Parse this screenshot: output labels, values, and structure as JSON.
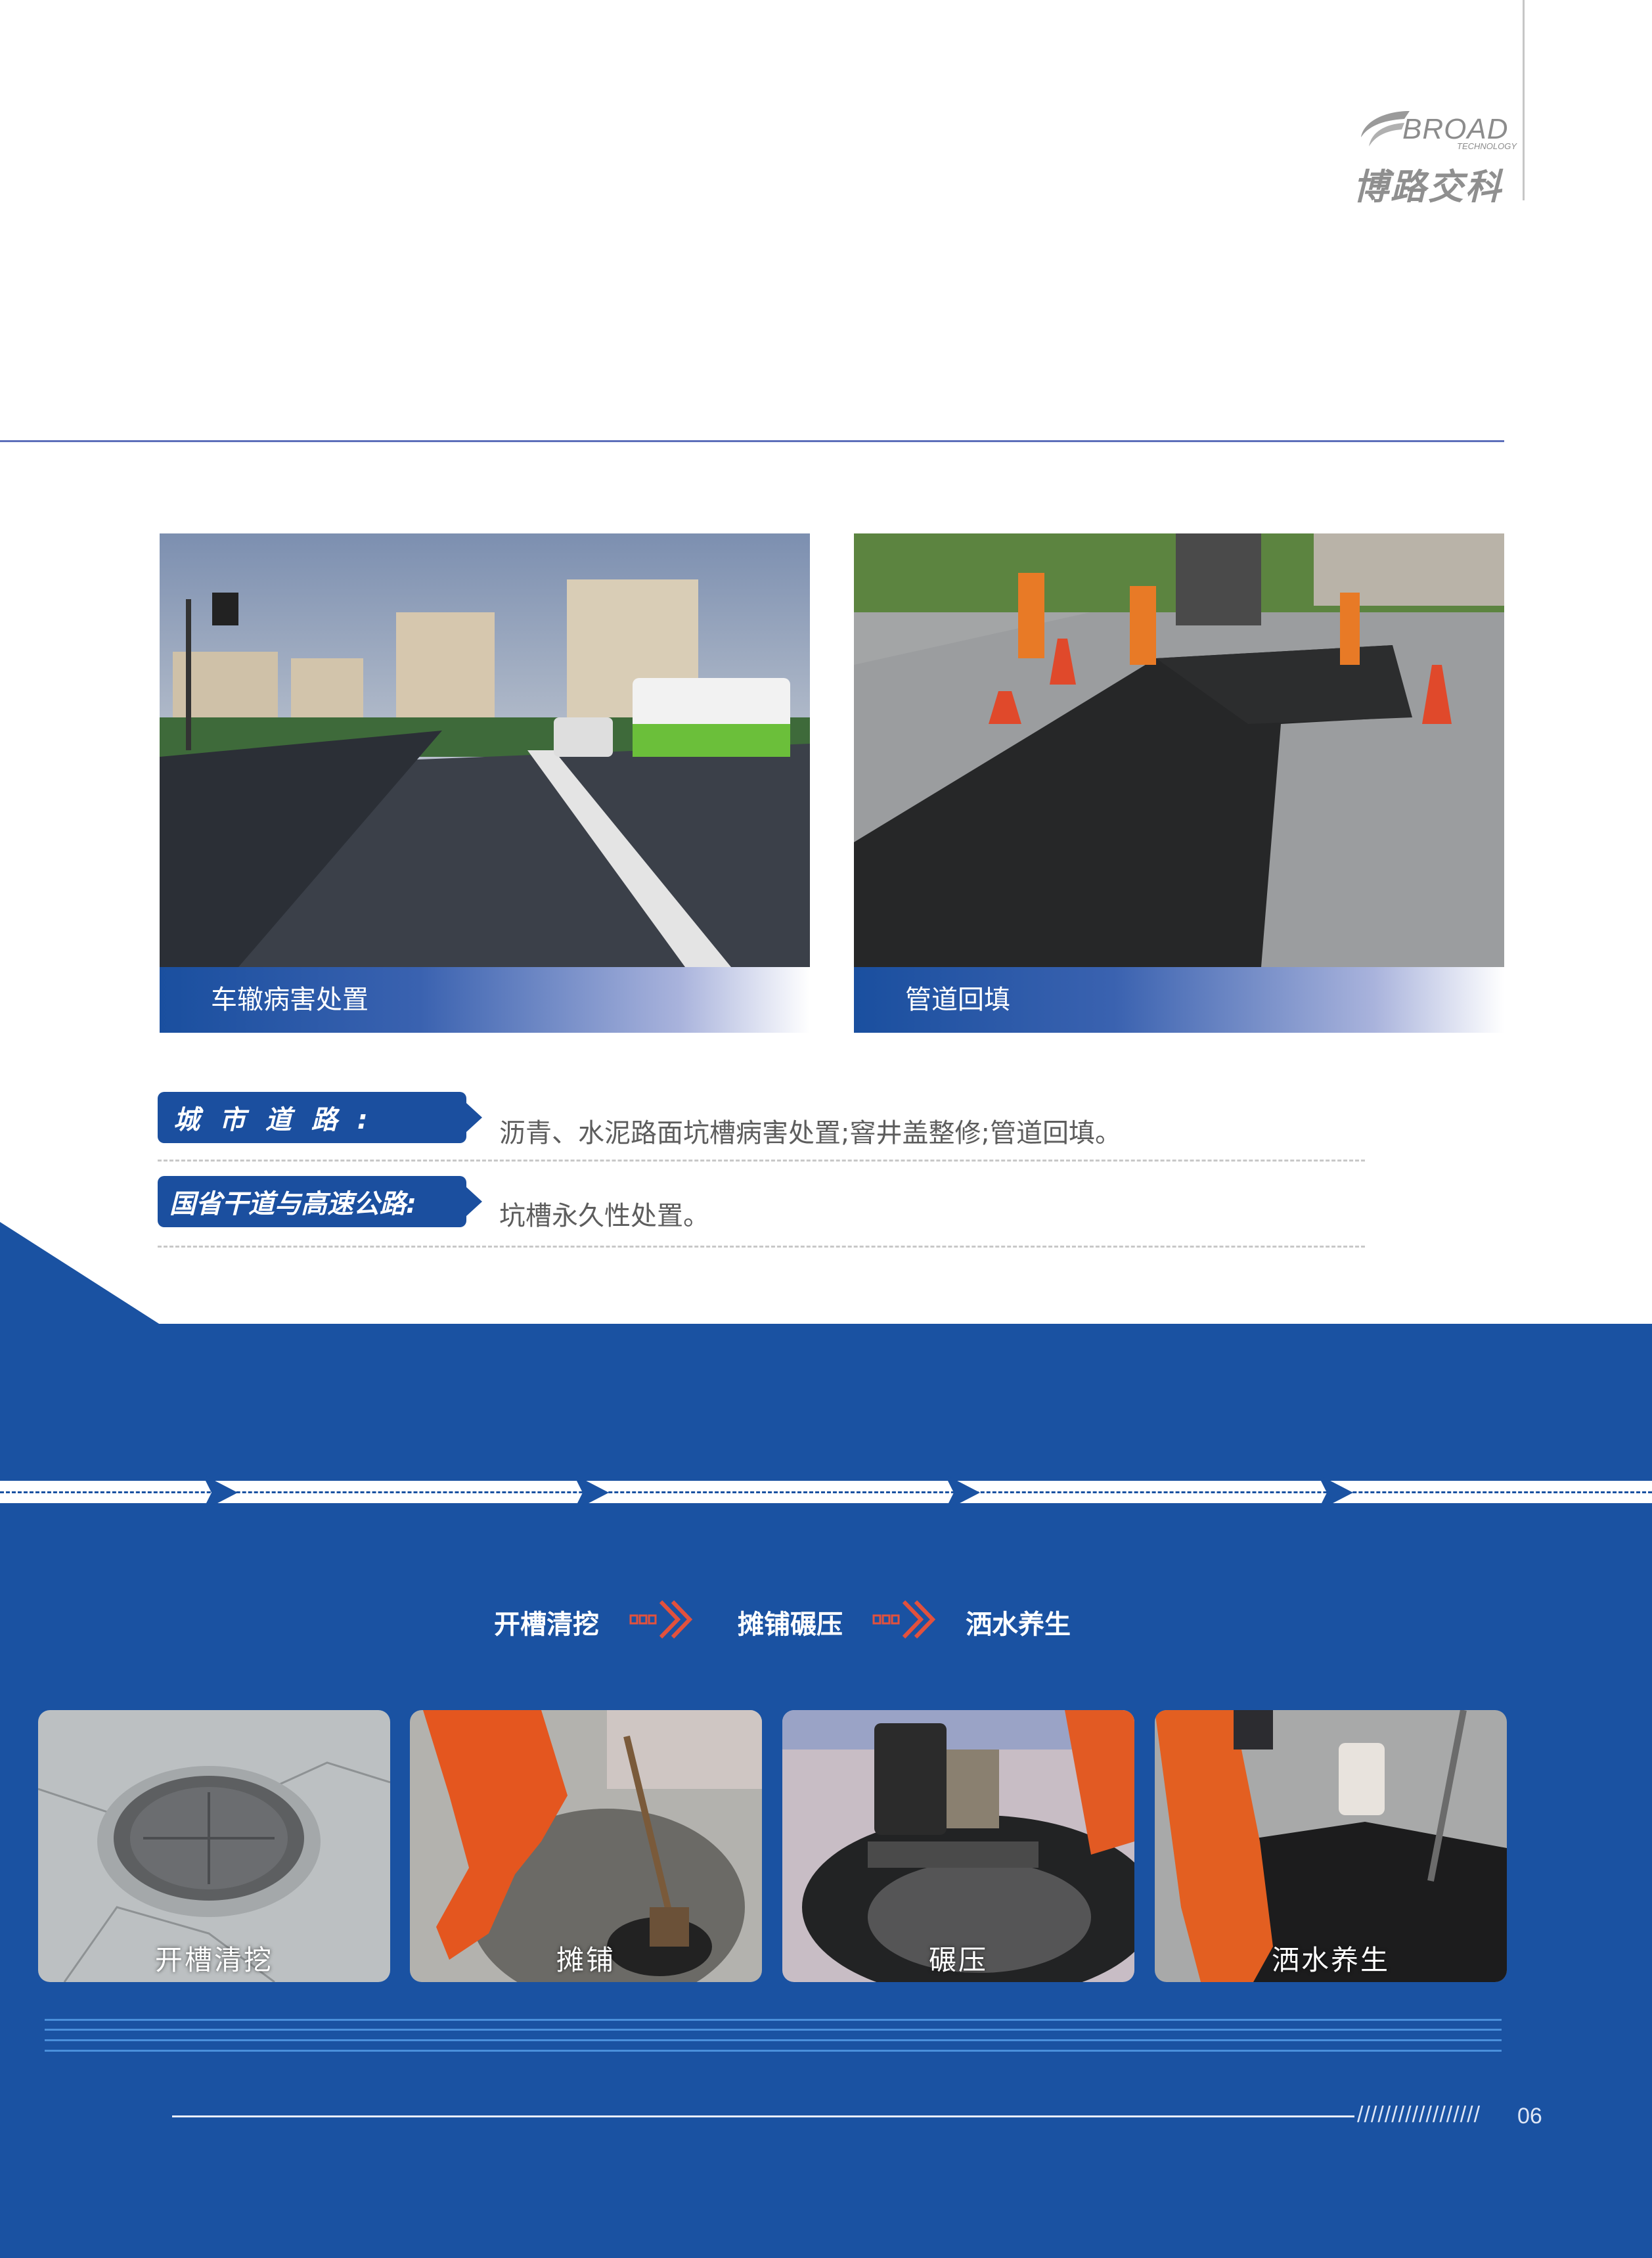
{
  "logo": {
    "english": "BROAD",
    "english_sub": "TECHNOLOGY",
    "chinese": "博路交科"
  },
  "photos": [
    {
      "caption": "车辙病害处置"
    },
    {
      "caption": "管道回填"
    }
  ],
  "categories": [
    {
      "tag": "城 市 道 路 :",
      "description": "沥青、水泥路面坑槽病害处置;窨井盖整修;管道回填。"
    },
    {
      "tag": "国省干道与高速公路:",
      "description": "坑槽永久性处置。"
    }
  ],
  "process_flow": {
    "steps": [
      "开槽清挖",
      "摊铺碾压",
      "洒水养生"
    ],
    "arrow_icon": "double-chevron-icon"
  },
  "step_photos": [
    {
      "label": "开槽清挖"
    },
    {
      "label": "摊铺"
    },
    {
      "label": "碾压"
    },
    {
      "label": "洒水养生"
    }
  ],
  "footer": {
    "slashes": "//////////////////",
    "page_number": "06"
  },
  "colors": {
    "brand_blue": "#1a52a2",
    "tag_blue": "#1b4f9f",
    "flow_arrow": "#e2513d"
  }
}
